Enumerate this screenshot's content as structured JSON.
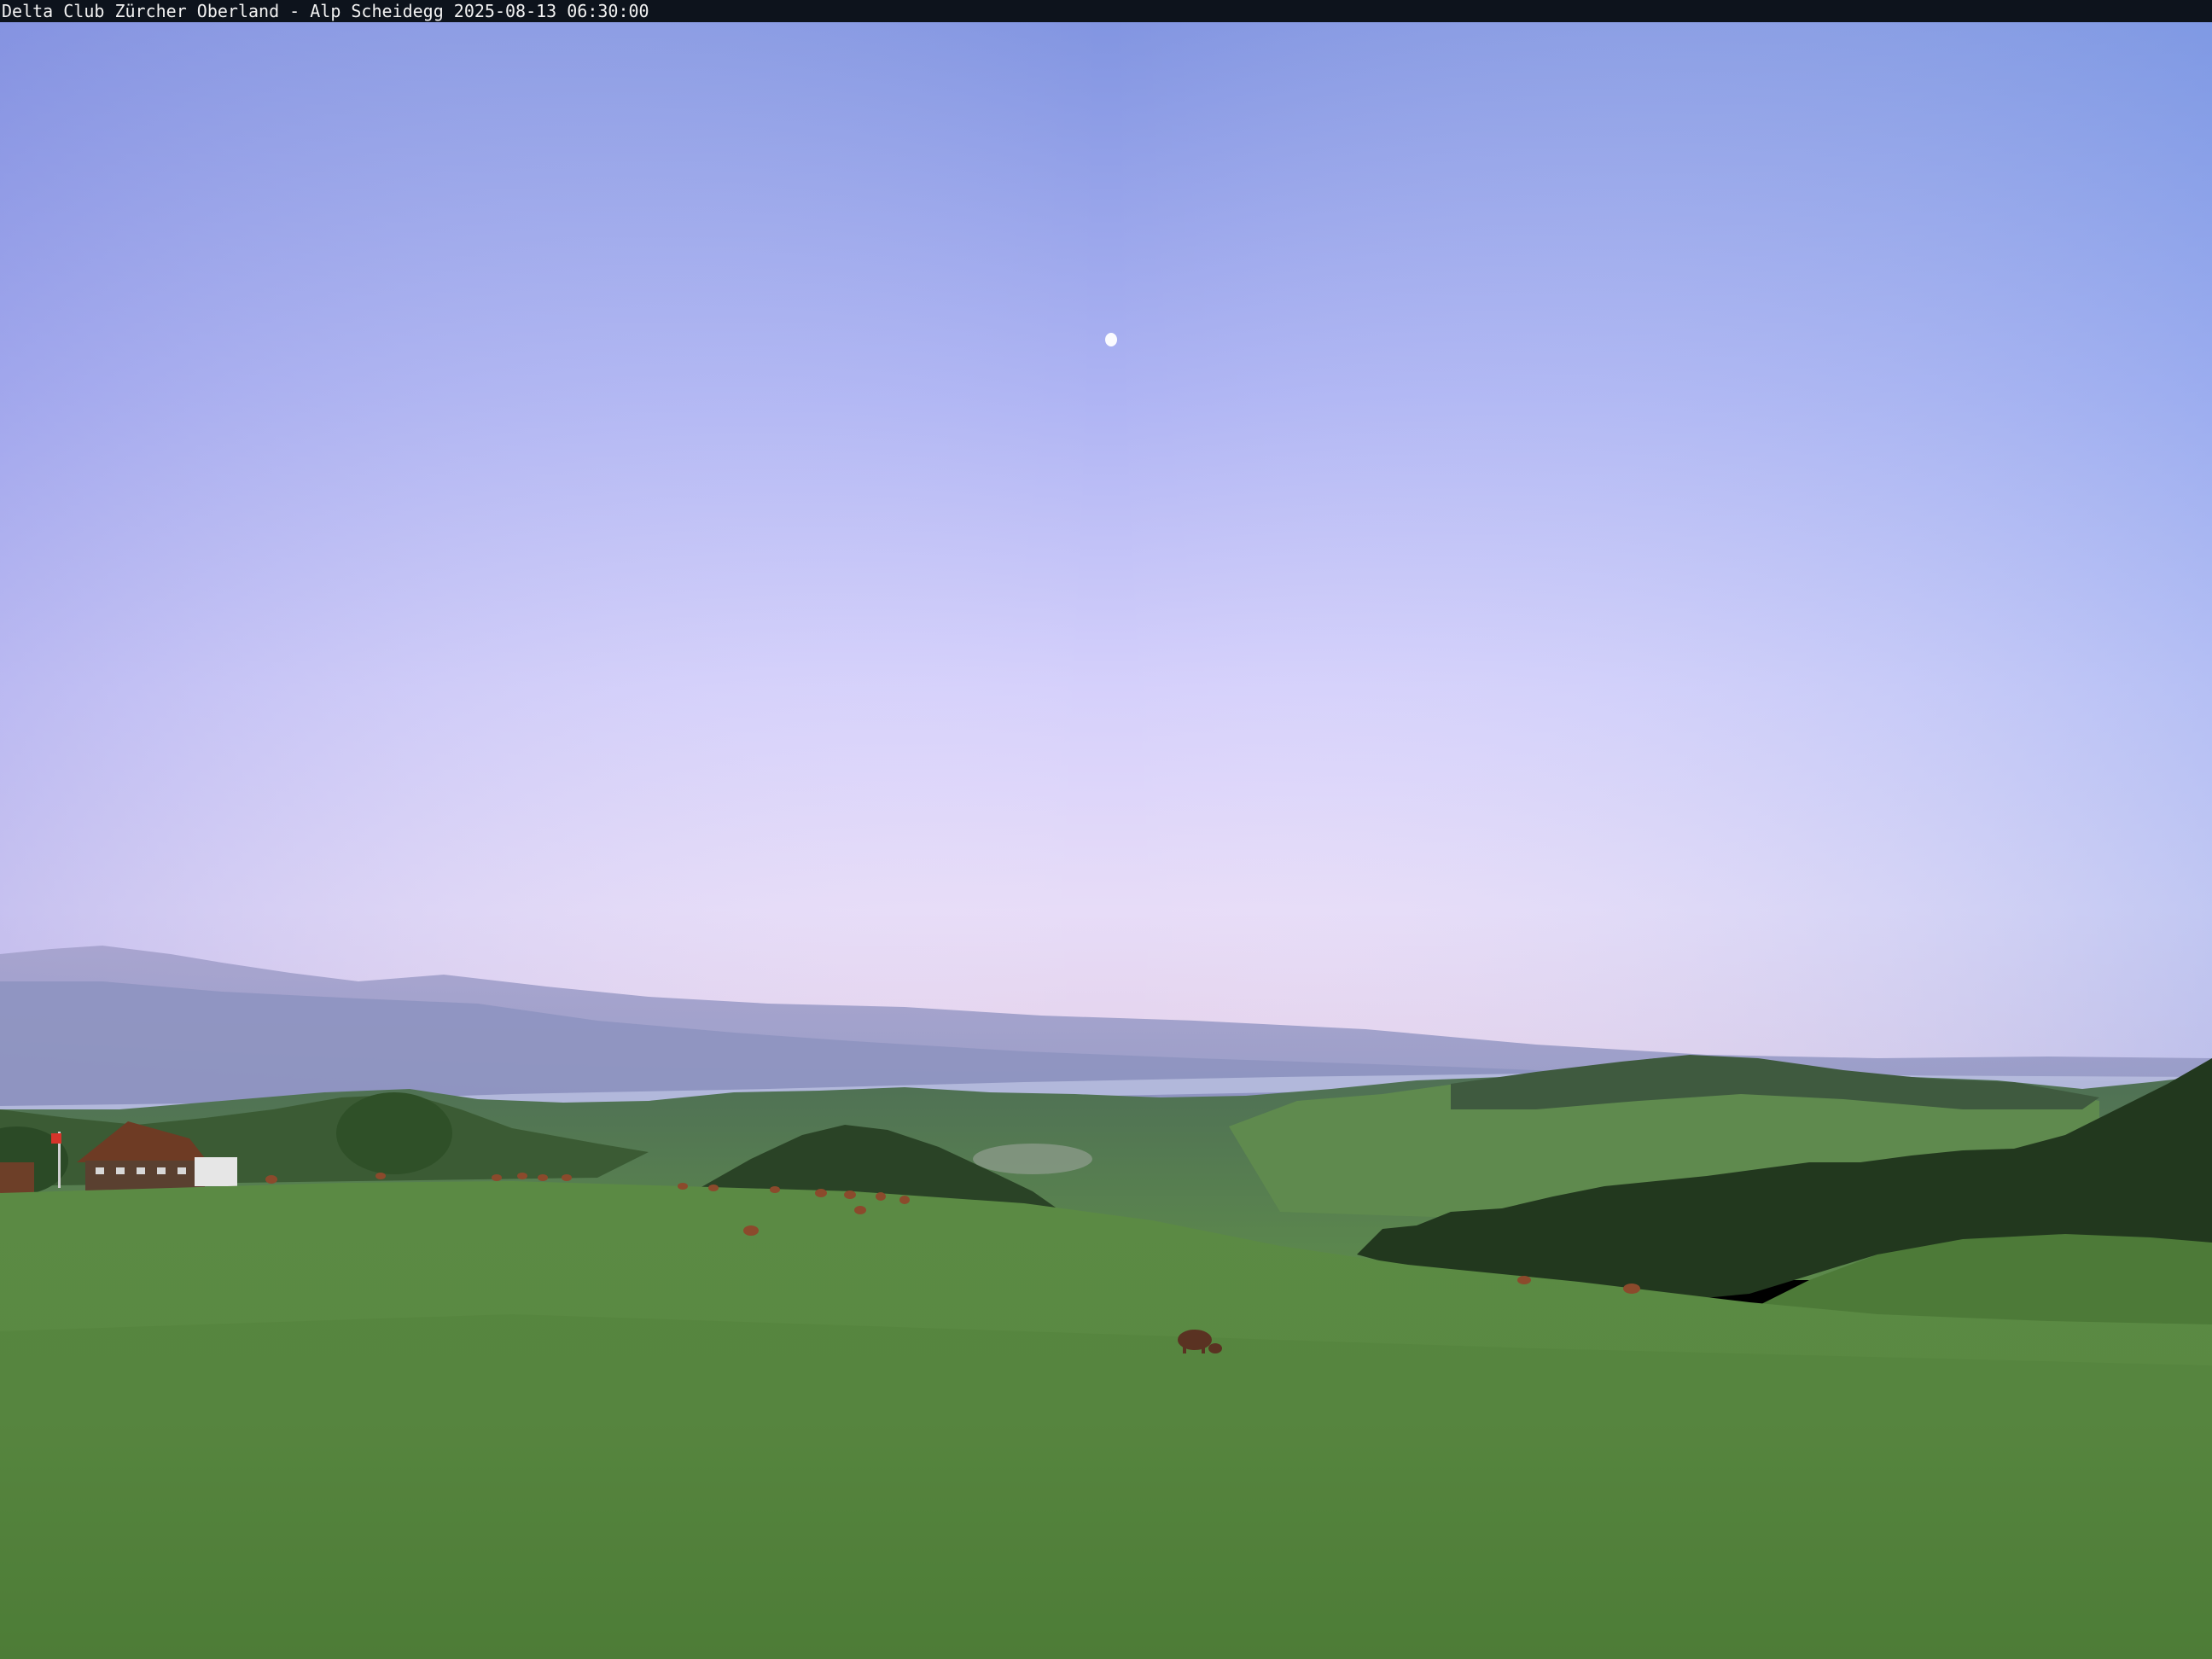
{
  "webcam": {
    "caption": "Delta Club Zürcher Oberland - Alp Scheidegg 2025-08-13 06:30:00"
  },
  "colors": {
    "sky_top": "#7f95e2",
    "sky_mid": "#c6c4fa",
    "sky_horizon": "#e7dcf8",
    "haze_pink": "#e2cbe6",
    "far_mountains": "#9d9cc6",
    "lake": "#b7bde0",
    "meadow_light": "#5f8c45",
    "meadow_dark": "#3d6a2a",
    "forest": "#23391f",
    "cow": "#8a4a2c",
    "moon": "#ffffff"
  }
}
